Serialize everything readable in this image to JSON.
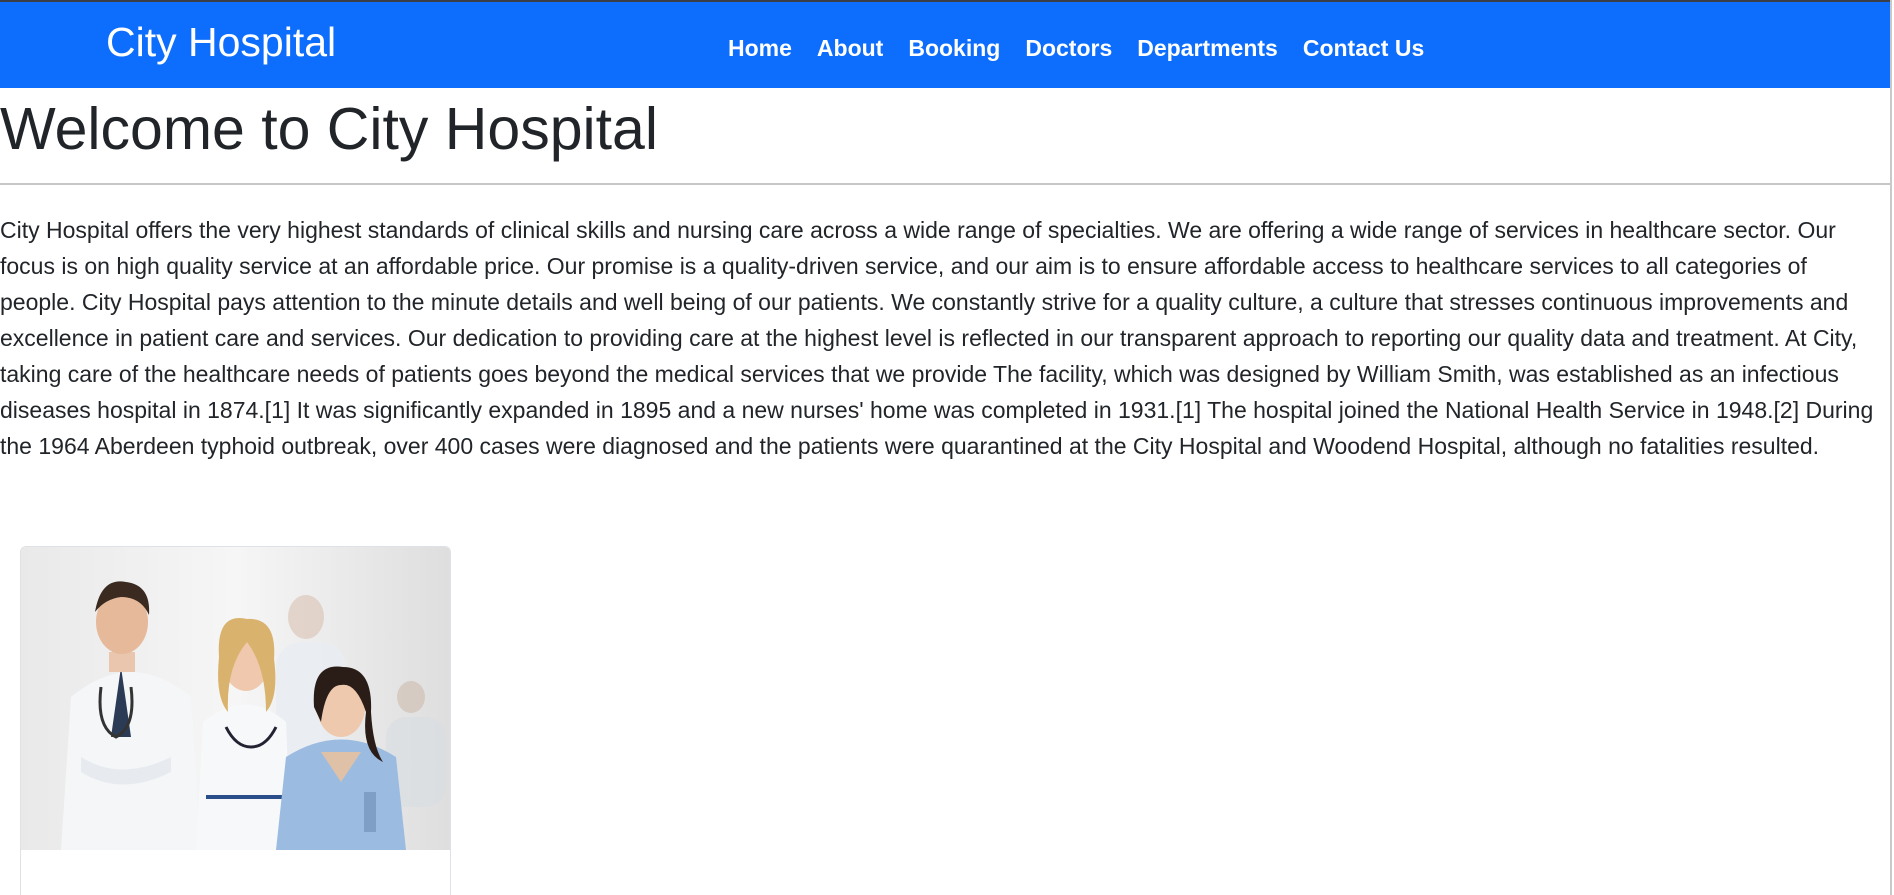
{
  "navbar": {
    "brand": "City Hospital",
    "links": [
      {
        "label": "Home"
      },
      {
        "label": "About"
      },
      {
        "label": "Booking"
      },
      {
        "label": "Doctors"
      },
      {
        "label": "Departments"
      },
      {
        "label": "Contact Us"
      }
    ],
    "background_color": "#0d6efd"
  },
  "main": {
    "heading": "Welcome to City Hospital",
    "intro": "City Hospital offers the very highest standards of clinical skills and nursing care across a wide range of specialties. We are offering a wide range of services in healthcare sector. Our focus is on high quality service at an affordable price. Our promise is a quality-driven service, and our aim is to ensure affordable access to healthcare services to all categories of people. City Hospital pays attention to the minute details and well being of our patients. We constantly strive for a quality culture, a culture that stresses continuous improvements and excellence in patient care and services. Our dedication to providing care at the highest level is reflected in our transparent approach to reporting our quality data and treatment. At City, taking care of the healthcare needs of patients goes beyond the medical services that we provide The facility, which was designed by William Smith, was established as an infectious diseases hospital in 1874.[1] It was significantly expanded in 1895 and a new nurses' home was completed in 1931.[1] The hospital joined the National Health Service in 1948.[2] During the 1964 Aberdeen typhoid outbreak, over 400 cases were diagnosed and the patients were quarantined at the City Hospital and Woodend Hospital, although no fatalities resulted."
  },
  "card": {
    "image_icon": "medical-staff-photo"
  }
}
